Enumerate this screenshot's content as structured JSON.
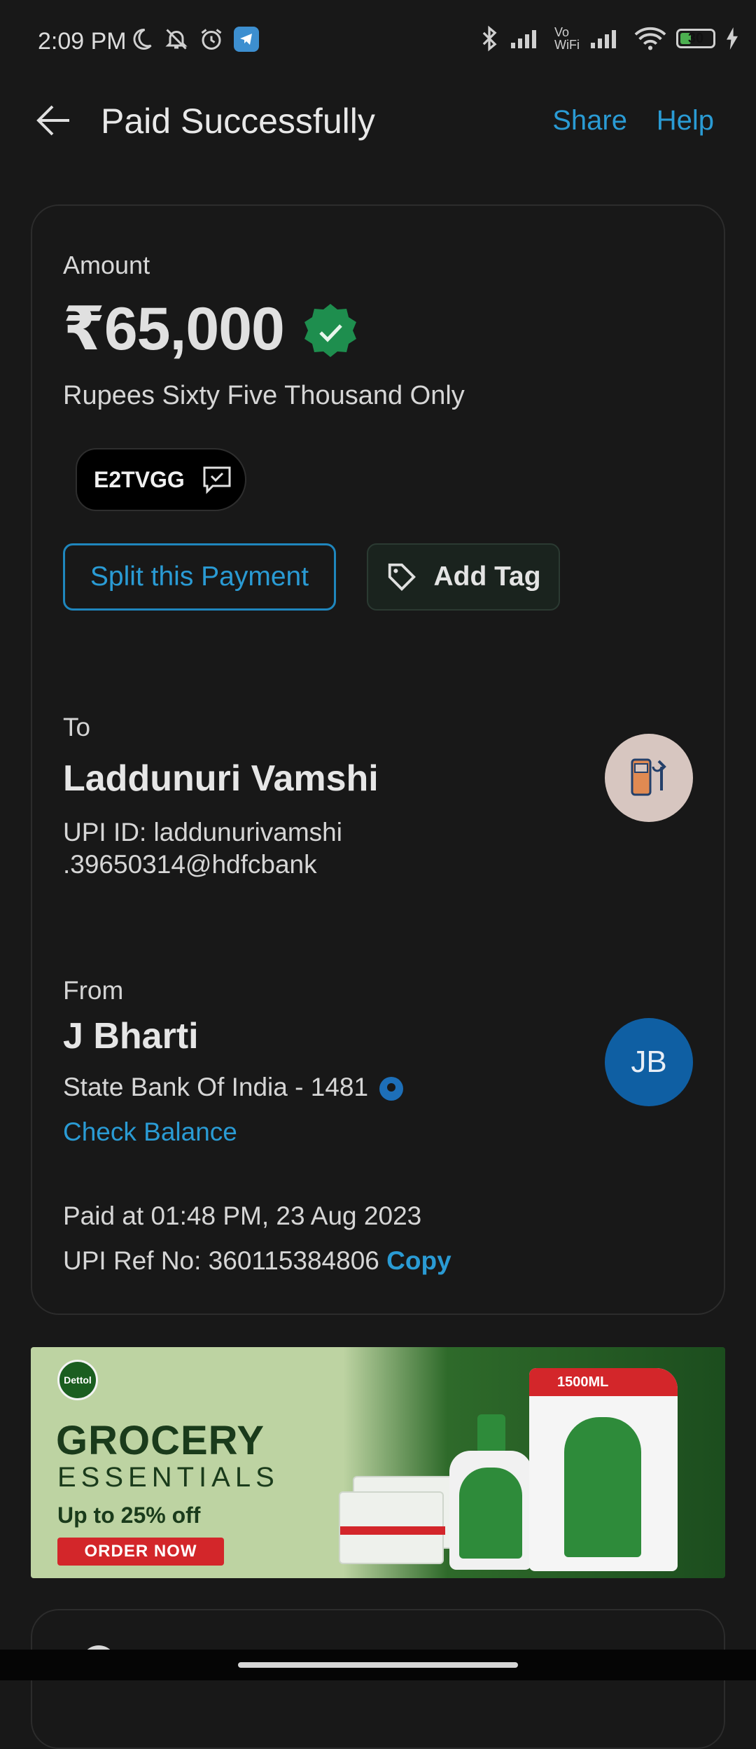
{
  "status_bar": {
    "time": "2:09 PM",
    "wifi_label_top": "Vo",
    "wifi_label_bottom": "WiFi",
    "battery_level": "30",
    "battery_color": "#4caf50"
  },
  "header": {
    "title": "Paid Successfully",
    "share_label": "Share",
    "help_label": "Help"
  },
  "payment": {
    "amount_label": "Amount",
    "amount": "₹65,000",
    "amount_words": "Rupees Sixty Five Thousand Only",
    "ref_chip": "E2TVGG",
    "split_label": "Split this Payment",
    "tag_label": "Add Tag",
    "verified_color": "#1e8e4e"
  },
  "to": {
    "label": "To",
    "name": "Laddunuri Vamshi",
    "upi_line1": "UPI ID: laddunurivamshi",
    "upi_line2": ".39650314@hdfcbank",
    "avatar_icon": "fuel-station-icon"
  },
  "from": {
    "label": "From",
    "name": "J Bharti",
    "bank": "State Bank Of India - 1481",
    "check_balance": "Check Balance",
    "initials": "JB"
  },
  "meta": {
    "paid_at": "Paid at 01:48 PM, 23 Aug 2023",
    "ref_prefix": "UPI Ref No: 360115384806",
    "copy_label": "Copy"
  },
  "banner": {
    "brand": "Dettol",
    "line1": "GROCERY",
    "line2": "ESSENTIALS",
    "offer": "Up to 25% off",
    "cta": "ORDER NOW",
    "pouch_size": "1500ML"
  },
  "colors": {
    "accent": "#2a9bd4",
    "background": "#181818",
    "avatar_blue": "#0f5fa3"
  }
}
